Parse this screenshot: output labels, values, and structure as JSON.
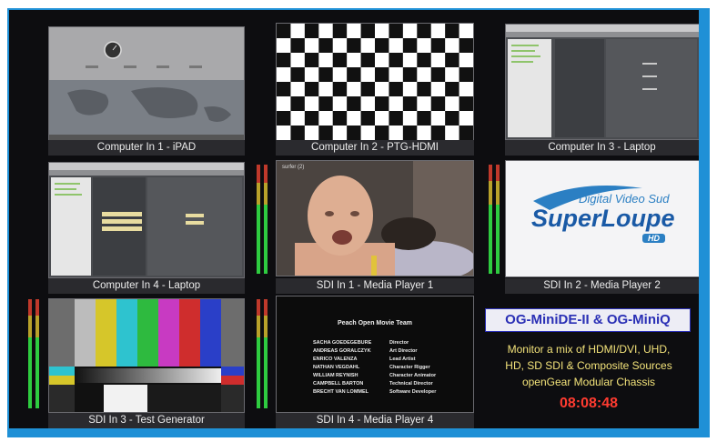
{
  "tiles": {
    "t1": {
      "label": "Computer In 1  -  iPAD"
    },
    "t2": {
      "label": "Computer In 2  -  PTG-HDMI"
    },
    "t3": {
      "label": "Computer In 3  -  Laptop"
    },
    "t4": {
      "label": "Computer In 4  -  Laptop"
    },
    "t5": {
      "label": "SDI In 1  -  Media Player 1"
    },
    "t6": {
      "label": "SDI In 2  -  Media Player 2"
    },
    "t7": {
      "label": "SDI In 3  -  Test Generator"
    },
    "t8": {
      "label": "SDI In 4  -  Media Player 4"
    }
  },
  "superloupe": {
    "brand": "Digital Video Sud",
    "name": "SuperLoupe",
    "badge": "HD"
  },
  "credits": {
    "title": "Peach Open Movie Team",
    "rows": [
      {
        "name": "SACHA GOEDEGEBURE",
        "role": "Director"
      },
      {
        "name": "ANDREAS GORALCZYK",
        "role": "Art Director"
      },
      {
        "name": "ENRICO VALENZA",
        "role": "Lead Artist"
      },
      {
        "name": "NATHAN VEGDAHL",
        "role": "Character Rigger"
      },
      {
        "name": "WILLIAM REYNISH",
        "role": "Character Animator"
      },
      {
        "name": "CAMPBELL BARTON",
        "role": "Technical Director"
      },
      {
        "name": "BRECHT VAN LOMMEL",
        "role": "Software Developer"
      }
    ]
  },
  "media_caption": "surfer (2)",
  "info": {
    "title": "OG-MiniDE-II & OG-MiniQ",
    "line1": "Monitor a mix of  HDMI/DVI, UHD,",
    "line2": "HD, SD SDI & Composite Sources",
    "line3": "openGear Modular Chassis",
    "clock": "08:08:48"
  },
  "colors": {
    "frame": "#1f90d6",
    "title_bg": "#2a2fb5",
    "clock": "#ff3b30",
    "info_text": "#f3e37a"
  }
}
